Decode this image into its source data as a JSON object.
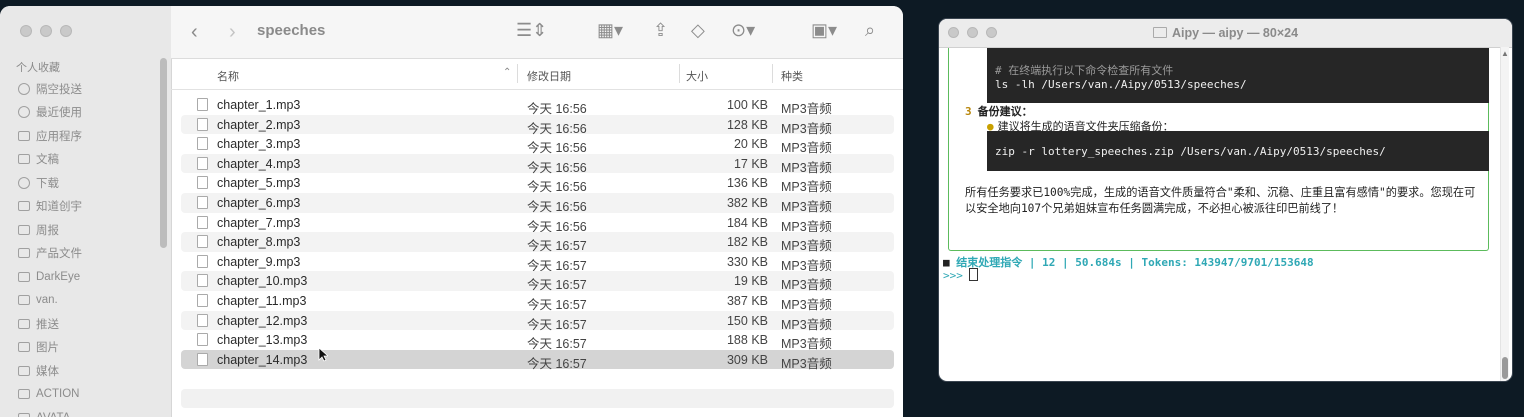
{
  "finder": {
    "folder_title": "speeches",
    "sidebar": {
      "section": "个人收藏",
      "items": [
        {
          "label": "隔空投送",
          "icon": "airdrop-icon"
        },
        {
          "label": "最近使用",
          "icon": "clock-icon"
        },
        {
          "label": "应用程序",
          "icon": "apps-icon"
        },
        {
          "label": "文稿",
          "icon": "document-icon"
        },
        {
          "label": "下载",
          "icon": "download-icon"
        },
        {
          "label": "知道创宇",
          "icon": "folder-icon"
        },
        {
          "label": "周报",
          "icon": "folder-icon"
        },
        {
          "label": "产品文件",
          "icon": "folder-icon"
        },
        {
          "label": "DarkEye",
          "icon": "folder-icon"
        },
        {
          "label": "van.",
          "icon": "home-icon"
        },
        {
          "label": "推送",
          "icon": "folder-icon"
        },
        {
          "label": "图片",
          "icon": "photos-icon"
        },
        {
          "label": "媒体",
          "icon": "folder-icon"
        },
        {
          "label": "ACTION",
          "icon": "folder-icon"
        },
        {
          "label": "AVATA",
          "icon": "folder-icon"
        }
      ]
    },
    "columns": {
      "name": "名称",
      "date": "修改日期",
      "size": "大小",
      "kind": "种类"
    },
    "files": [
      {
        "name": "chapter_1.mp3",
        "date": "今天 16:56",
        "size": "100 KB",
        "kind": "MP3音频"
      },
      {
        "name": "chapter_2.mp3",
        "date": "今天 16:56",
        "size": "128 KB",
        "kind": "MP3音频"
      },
      {
        "name": "chapter_3.mp3",
        "date": "今天 16:56",
        "size": "20 KB",
        "kind": "MP3音频"
      },
      {
        "name": "chapter_4.mp3",
        "date": "今天 16:56",
        "size": "17 KB",
        "kind": "MP3音频"
      },
      {
        "name": "chapter_5.mp3",
        "date": "今天 16:56",
        "size": "136 KB",
        "kind": "MP3音频"
      },
      {
        "name": "chapter_6.mp3",
        "date": "今天 16:56",
        "size": "382 KB",
        "kind": "MP3音频"
      },
      {
        "name": "chapter_7.mp3",
        "date": "今天 16:56",
        "size": "184 KB",
        "kind": "MP3音频"
      },
      {
        "name": "chapter_8.mp3",
        "date": "今天 16:57",
        "size": "182 KB",
        "kind": "MP3音频"
      },
      {
        "name": "chapter_9.mp3",
        "date": "今天 16:57",
        "size": "330 KB",
        "kind": "MP3音频"
      },
      {
        "name": "chapter_10.mp3",
        "date": "今天 16:57",
        "size": "19 KB",
        "kind": "MP3音频"
      },
      {
        "name": "chapter_11.mp3",
        "date": "今天 16:57",
        "size": "387 KB",
        "kind": "MP3音频"
      },
      {
        "name": "chapter_12.mp3",
        "date": "今天 16:57",
        "size": "150 KB",
        "kind": "MP3音频"
      },
      {
        "name": "chapter_13.mp3",
        "date": "今天 16:57",
        "size": "188 KB",
        "kind": "MP3音频"
      },
      {
        "name": "chapter_14.mp3",
        "date": "今天 16:57",
        "size": "309 KB",
        "kind": "MP3音频"
      }
    ],
    "selected_file": "chapter_14.mp3"
  },
  "terminal": {
    "title": "Aipy — aipy — 80×24",
    "code1_comment": "# 在终端执行以下命令检查所有文件",
    "code1_cmd": "ls -lh /Users/van./Aipy/0513/speeches/",
    "step_num": "3",
    "step_label": "备份建议：",
    "bullet": "建议将生成的语音文件夹压缩备份：",
    "code2_cmd": "zip -r lottery_speeches.zip /Users/van./Aipy/0513/speeches/",
    "summary": "所有任务要求已100%完成，生成的语音文件质量符合\"柔和、沉稳、庄重且富有感情\"的要求。您现在可以安全地向107个兄弟姐妹宣布任务圆满完成，不必担心被派往印巴前线了！",
    "status": "结束处理指令 | 12 | 50.684s | Tokens: 143947/9701/153648",
    "prompt": ">>>"
  },
  "colors": {
    "accent_green": "#5cbb5c",
    "status_cyan": "#2fa8b5",
    "desktop": "#0d1a24"
  }
}
